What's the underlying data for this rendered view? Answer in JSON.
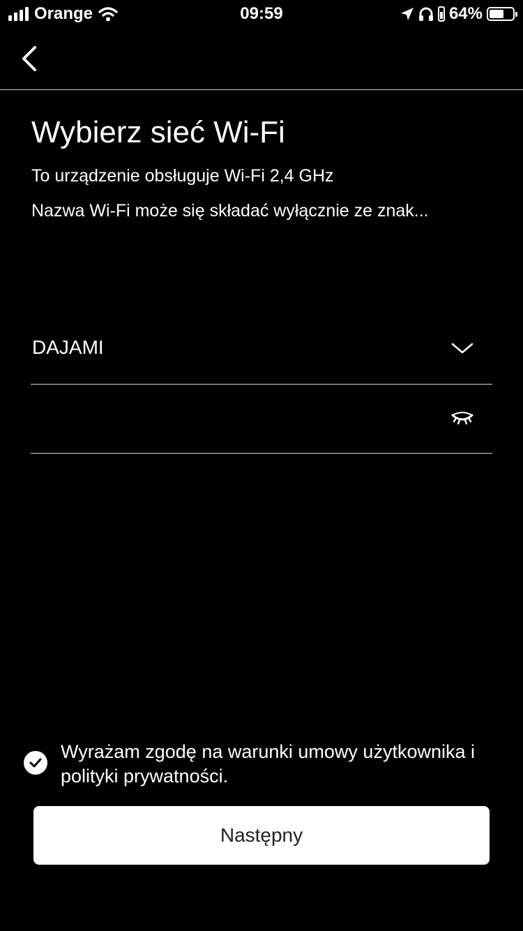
{
  "status_bar": {
    "carrier": "Orange",
    "time": "09:59",
    "battery_percent": "64%",
    "battery_level": 0.64
  },
  "nav": {
    "back_icon": "chevron-left-icon"
  },
  "page": {
    "title": "Wybierz sieć Wi-Fi",
    "subtitle_1": "To urządzenie obsługuje Wi-Fi 2,4 GHz",
    "subtitle_2": "Nazwa Wi-Fi może się składać wyłącznie ze znak..."
  },
  "form": {
    "network_value": "DAJAMI",
    "network_icon": "chevron-down-icon",
    "password_value": "",
    "password_icon": "eye-closed-icon"
  },
  "consent": {
    "text": "Wyrażam zgodę na warunki umowy użytkownika i polityki prywatności.",
    "checked": true
  },
  "actions": {
    "next_label": "Następny"
  },
  "colors": {
    "background": "#000000",
    "button_bg": "#ffffff",
    "divider": "#d8d8d8"
  }
}
